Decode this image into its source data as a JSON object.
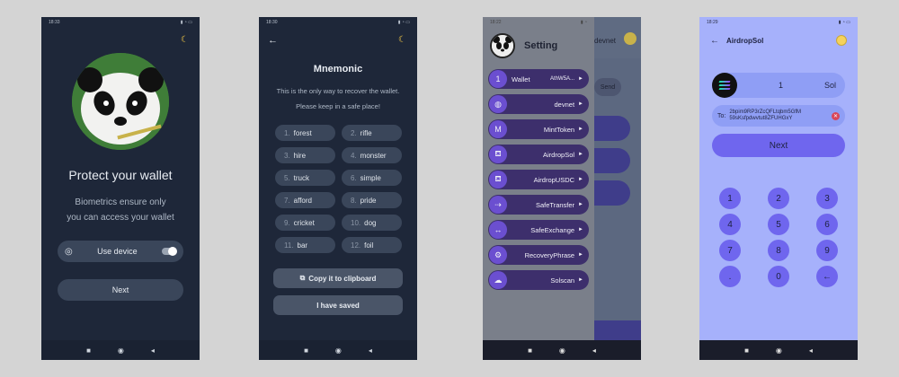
{
  "screen1": {
    "time": "18:33",
    "title": "Protect your wallet",
    "subtitle_line1": "Biometrics ensure only",
    "subtitle_line2": "you can access your wallet",
    "use_device_label": "Use device",
    "next_label": "Next"
  },
  "screen2": {
    "time": "18:30",
    "title": "Mnemonic",
    "desc_line1": "This is the only way to recover the wallet.",
    "desc_line2": "Please keep in a safe place!",
    "words": [
      {
        "n": "1.",
        "w": "forest"
      },
      {
        "n": "2.",
        "w": "rifle"
      },
      {
        "n": "3.",
        "w": "hire"
      },
      {
        "n": "4.",
        "w": "monster"
      },
      {
        "n": "5.",
        "w": "truck"
      },
      {
        "n": "6.",
        "w": "simple"
      },
      {
        "n": "7.",
        "w": "afford"
      },
      {
        "n": "8.",
        "w": "pride"
      },
      {
        "n": "9.",
        "w": "cricket"
      },
      {
        "n": "10.",
        "w": "dog"
      },
      {
        "n": "11.",
        "w": "bar"
      },
      {
        "n": "12.",
        "w": "foil"
      }
    ],
    "copy_label": "Copy it to clipboard",
    "saved_label": "I have saved"
  },
  "screen3": {
    "time": "18:22",
    "title": "Setting",
    "bg_header": "devnet",
    "bg_send": "Send",
    "items": [
      {
        "icon": "1",
        "label": "Wallet",
        "value": "AthW5A..."
      },
      {
        "icon": "◍",
        "label": "",
        "value": "devnet"
      },
      {
        "icon": "M",
        "label": "",
        "value": "MintToken"
      },
      {
        "icon": "⛾",
        "label": "",
        "value": "AirdropSol"
      },
      {
        "icon": "⛾",
        "label": "",
        "value": "AirdropUSDC"
      },
      {
        "icon": "⇢",
        "label": "",
        "value": "SafeTransfer"
      },
      {
        "icon": "↔",
        "label": "",
        "value": "SafeExchange"
      },
      {
        "icon": "⚙",
        "label": "",
        "value": "RecoveryPhrase"
      },
      {
        "icon": "☁",
        "label": "",
        "value": "Solscan"
      }
    ]
  },
  "screen4": {
    "time": "18:29",
    "title": "AirdropSol",
    "amount": "1",
    "unit": "Sol",
    "to_label": "To:",
    "address_line1": "2bpim9RP3rZcQFLtqbm5GfM",
    "address_line2": "59sKsfpdwvtut8ZFUHGxY",
    "next_label": "Next",
    "keys": [
      "1",
      "2",
      "3",
      "4",
      "5",
      "6",
      "7",
      "8",
      "9",
      ".",
      "0",
      "←"
    ]
  },
  "nav": {
    "square": "■",
    "circle": "◉",
    "back": "◂"
  },
  "colors": {
    "dark_bg": "#1e2739",
    "accent_purple": "#6f66ee",
    "light_purple_bg": "#a6b1fb",
    "moon": "#f6c945"
  }
}
